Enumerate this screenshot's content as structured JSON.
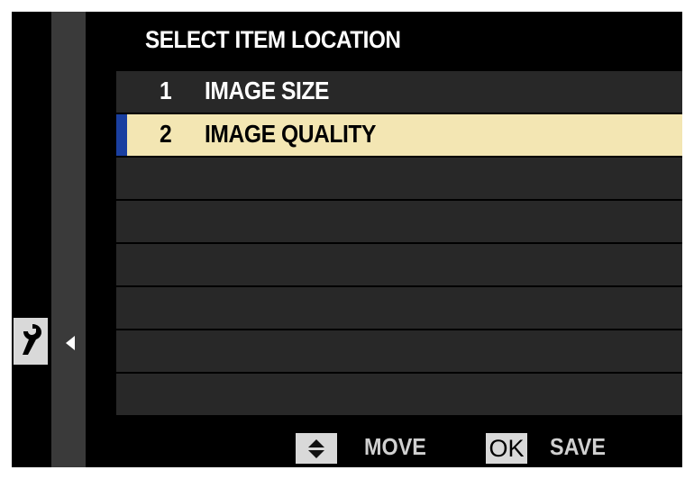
{
  "header": {
    "title": "SELECT ITEM LOCATION"
  },
  "list": {
    "items": [
      {
        "number": "1",
        "label": "IMAGE SIZE",
        "selected": false
      },
      {
        "number": "2",
        "label": "IMAGE QUALITY",
        "selected": true
      },
      {
        "number": "",
        "label": "",
        "selected": false
      },
      {
        "number": "",
        "label": "",
        "selected": false
      },
      {
        "number": "",
        "label": "",
        "selected": false
      },
      {
        "number": "",
        "label": "",
        "selected": false
      },
      {
        "number": "",
        "label": "",
        "selected": false
      },
      {
        "number": "",
        "label": "",
        "selected": false
      }
    ]
  },
  "footer": {
    "move_label": "MOVE",
    "ok_label": "OK",
    "save_label": "SAVE"
  },
  "icons": {
    "sidebar": "wrench-icon",
    "back": "triangle-left-icon",
    "move": "up-down-arrows-icon"
  },
  "colors": {
    "background": "#000000",
    "row": "#282828",
    "selected_row": "#f3e6b3",
    "selection_bar": "#1a3fa0",
    "rail": "#3a3a3a"
  }
}
